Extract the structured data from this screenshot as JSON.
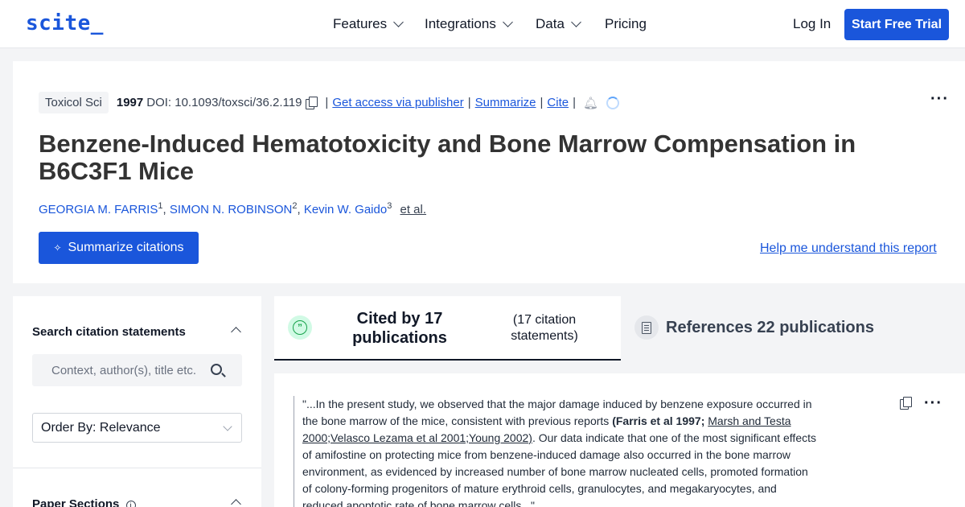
{
  "nav": {
    "logo": "scite_",
    "items": [
      {
        "label": "Features"
      },
      {
        "label": "Integrations"
      },
      {
        "label": "Data"
      },
      {
        "label": "Pricing"
      }
    ],
    "login": "Log In",
    "trial": "Start Free Trial"
  },
  "paper": {
    "journal": "Toxicol Sci",
    "year": "1997",
    "doi": "DOI: 10.1093/toxsci/36.2.119",
    "access_link": "Get access via publisher",
    "summarize_link": "Summarize",
    "cite_link": "Cite",
    "title": "Benzene-Induced Hematotoxicity and Bone Marrow Compensation in B6C3F1 Mice",
    "authors": [
      {
        "name": "GEORGIA M. FARRIS",
        "aff": "1"
      },
      {
        "name": "SIMON N. ROBINSON",
        "aff": "2"
      },
      {
        "name": "Kevin W. Gaido",
        "aff": "3"
      }
    ],
    "etal": "et al.",
    "summarize_button": "Summarize citations",
    "help_link": "Help me understand this report"
  },
  "sidebar": {
    "search_heading": "Search citation statements",
    "search_placeholder": "Context, author(s), title etc.",
    "order_by": "Order By: Relevance",
    "sections_heading": "Paper Sections",
    "info_glyph": "i"
  },
  "tabs": {
    "cited_title": "Cited by 17 publications",
    "cited_sub": "(17 citation statements)",
    "refs_title": "References 22 publications"
  },
  "citation": {
    "text_1": "\"...In the present study, we observed that the major damage induced by benzene exposure occurred in the bone marrow of the mice, consistent with previous reports ",
    "ref_bold": "(Farris et al 1997;",
    "ref_links": "Marsh and Testa 2000;Velasco Lezama et al 2001;Young 2002)",
    "text_2": ". Our data indicate that one of the most significant effects of amifostine on protecting mice from benzene-induced damage also occurred in the bone marrow environment, as evidenced by increased number of bone marrow nucleated cells, promoted formation of colony-forming progenitors of mature erythroid cells, granulocytes, and megakaryocytes, and reduced apoptotic rate of bone marrow cells...\""
  }
}
